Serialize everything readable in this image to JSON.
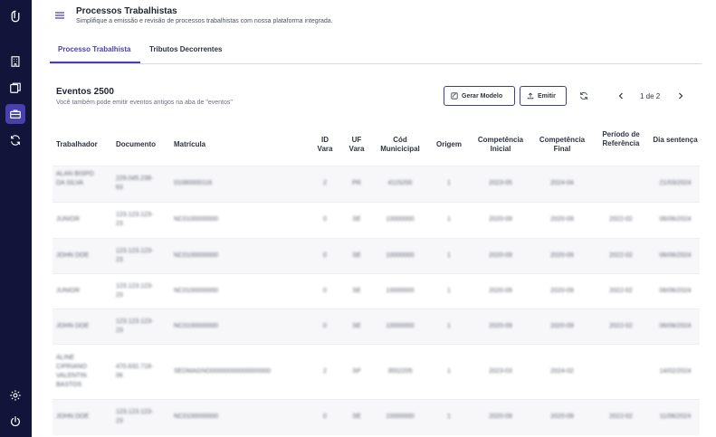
{
  "header": {
    "title": "Processos Trabalhistas",
    "subtitle": "Simplifique a emissão e revisão de processos trabalhistas com nossa plataforma integrada."
  },
  "tabs": [
    {
      "label": "Processo Trabalhista",
      "active": true
    },
    {
      "label": "Tributos Decorrentes",
      "active": false
    }
  ],
  "toolbar": {
    "title": "Eventos 2500",
    "subtitle": "Você também pode emitir eventos antigos na aba de \"eventos\"",
    "gerar_label": "Gerar Modelo",
    "emitir_label": "Emitir",
    "pagination": "1 de 2"
  },
  "table": {
    "columns": [
      "Trabalhador",
      "Documento",
      "Matrícula",
      "ID Vara",
      "UF Vara",
      "Cód Municicipal",
      "Origem",
      "Competência Inicial",
      "Competência Final",
      "Período de Referência",
      "Dia sentença"
    ],
    "rows": [
      [
        "ALAN BISPO DA SILVA",
        "229.045.238-63",
        "01080000116",
        "2",
        "PR",
        "4115200",
        "1",
        "2023-05",
        "2024-04",
        "",
        "21/03/2024"
      ],
      [
        "JUNIOR",
        "123.123.123-23",
        "NC0100000000",
        "0",
        "SE",
        "10000000",
        "1",
        "2020-09",
        "2020-09",
        "2022-02",
        "06/06/2024"
      ],
      [
        "JOHN DOE",
        "123.123.123-23",
        "NC0100000000",
        "0",
        "SE",
        "10000000",
        "1",
        "2020-09",
        "2020-09",
        "2022-02",
        "06/06/2024"
      ],
      [
        "JUNIOR",
        "123.123.123-23",
        "NC0100000000",
        "0",
        "SE",
        "10000000",
        "1",
        "2020-09",
        "2020-09",
        "2022-02",
        "06/06/2024"
      ],
      [
        "JOHN DOE",
        "123.123.123-23",
        "NC0100000000",
        "0",
        "SE",
        "10000000",
        "1",
        "2020-09",
        "2020-09",
        "2022-02",
        "06/06/2024"
      ],
      [
        "ALINE CIPRIANO VALENTIN BASTOS",
        "470.632.718-06",
        "SEDMAGNO00000000000000000",
        "2",
        "SP",
        "3552205",
        "1",
        "2023-03",
        "2024-02",
        "",
        "14/02/2024"
      ],
      [
        "JOHN DOE",
        "123.123.123-23",
        "NC0100000000",
        "0",
        "SE",
        "10000000",
        "1",
        "2020-09",
        "2020-09",
        "2022-02",
        "11/06/2024"
      ]
    ]
  },
  "sidebar": {
    "icons": [
      "logo-icon",
      "building-icon",
      "documents-icon",
      "briefcase-icon",
      "sync-icon",
      "settings-icon",
      "power-icon"
    ],
    "active_color": "#4a3fb0",
    "background": "#13143a"
  }
}
